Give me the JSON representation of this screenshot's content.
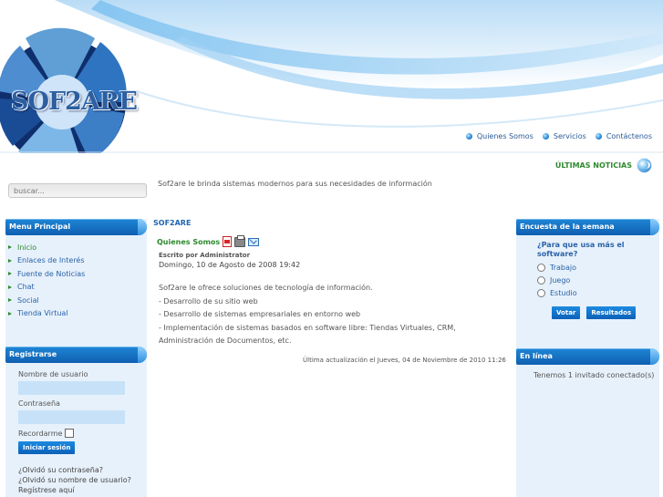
{
  "header": {
    "logo_text": "SOF2ARE",
    "nav": [
      {
        "label": "Quienes Somos"
      },
      {
        "label": "Servicios"
      },
      {
        "label": "Contáctenos"
      }
    ]
  },
  "search": {
    "placeholder": "buscar..."
  },
  "tagline": "Sof2are le brinda sistemas modernos para sus necesidades de información",
  "latest_news_label": "ÚLTIMAS NOTICIAS",
  "left": {
    "menu_title": "Menu Principal",
    "menu_items": [
      {
        "label": "Inicio",
        "active": true
      },
      {
        "label": "Enlaces de Interés"
      },
      {
        "label": "Fuente de Noticias"
      },
      {
        "label": "Chat"
      },
      {
        "label": "Social"
      },
      {
        "label": "Tienda Virtual"
      }
    ],
    "login_title": "Registrarse",
    "username_label": "Nombre de usuario",
    "password_label": "Contraseña",
    "remember_label": "Recordarme",
    "login_button": "Iniciar sesión",
    "links": [
      "¿Olvidó su contraseña?",
      "¿Olvidó su nombre de usuario?",
      "Regístrese aquí"
    ]
  },
  "content": {
    "section_title": "SOF2ARE",
    "article_title": "Quienes Somos",
    "author": "Escrito por Administrator",
    "date": "Domingo, 10 de Agosto de 2008 19:42",
    "paragraphs": [
      "Sof2are le ofrece soluciones de tecnología de información.",
      "- Desarrollo de su sitio web",
      "- Desarrollo de sistemas empresariales en entorno web",
      "- Implementación de sistemas basados en software libre: Tiendas Virtuales, CRM, Administración de Documentos, etc."
    ],
    "updated": "Última actualización el Jueves, 04 de Noviembre de 2010 11:26"
  },
  "right": {
    "poll_title": "Encuesta de la semana",
    "poll_question": "¿Para que usa más el software?",
    "poll_options": [
      "Trabajo",
      "Juego",
      "Estudio"
    ],
    "vote_button": "Votar",
    "results_button": "Resultados",
    "online_title": "En línea",
    "online_text": "Tenemos 1 invitado conectado(s)"
  },
  "colors": {
    "accent_blue": "#1570c8",
    "green_text": "#2e8a2e",
    "panel_bg": "#e7f1fb"
  }
}
